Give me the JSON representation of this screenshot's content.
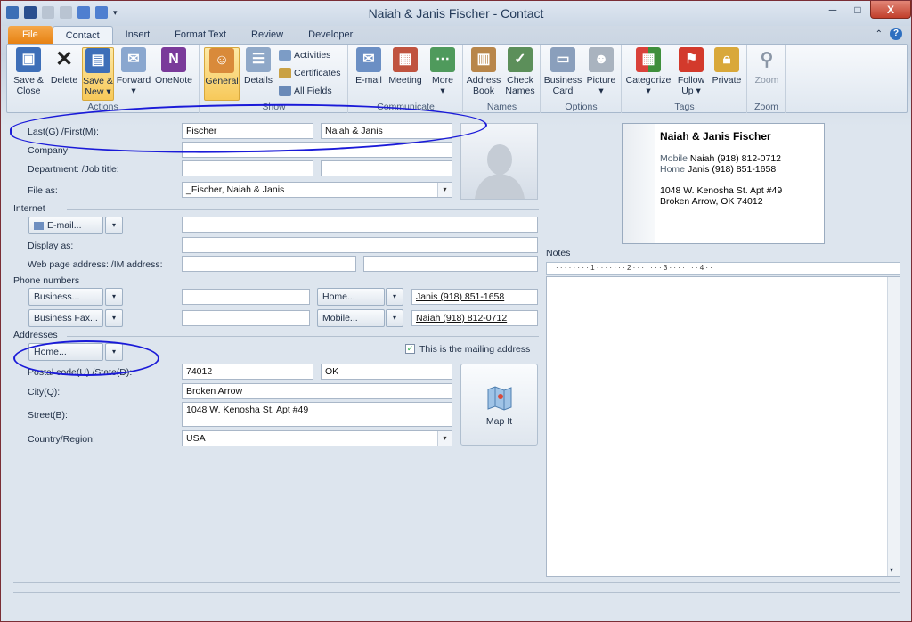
{
  "window": {
    "title": "Naiah & Janis Fischer  -  Contact",
    "controls": {
      "minimize": "─",
      "maximize": "□",
      "close": "X"
    }
  },
  "tabs": [
    "File",
    "Contact",
    "Insert",
    "Format Text",
    "Review",
    "Developer"
  ],
  "ribbon": {
    "actions": {
      "label": "Actions",
      "save_close": "Save &\nClose",
      "delete": "Delete",
      "save_new": "Save &\nNew ▾",
      "forward": "Forward\n▾",
      "onenote": "OneNote"
    },
    "show": {
      "label": "Show",
      "general": "General",
      "details": "Details",
      "activities": "Activities",
      "certificates": "Certificates",
      "all_fields": "All Fields"
    },
    "communicate": {
      "label": "Communicate",
      "email": "E-mail",
      "meeting": "Meeting",
      "more": "More\n▾"
    },
    "names": {
      "label": "Names",
      "address_book": "Address\nBook",
      "check_names": "Check\nNames"
    },
    "options": {
      "label": "Options",
      "business_card": "Business\nCard",
      "picture": "Picture\n▾"
    },
    "tags": {
      "label": "Tags",
      "categorize": "Categorize\n▾",
      "follow_up": "Follow\nUp ▾",
      "private": "Private"
    },
    "zoom": {
      "label": "Zoom",
      "zoom": "Zoom"
    }
  },
  "form": {
    "last_first_label": "Last(G)   /First(M):",
    "last": "Fischer",
    "first": "Naiah & Janis",
    "company_label": "Company:",
    "department_label": "Department:   /Job title:",
    "file_as_label": "File as:",
    "file_as": "_Fischer, Naiah & Janis",
    "internet_section": "Internet",
    "email_button": "E-mail...",
    "display_as_label": "Display as:",
    "webpage_label": "Web page address:   /IM address:",
    "phone_section": "Phone numbers",
    "business_btn": "Business...",
    "business_fax_btn": "Business Fax...",
    "home_btn": "Home...",
    "mobile_btn": "Mobile...",
    "home_phone": "Janis (918) 851-1658",
    "mobile_phone": "Naiah (918) 812-0712",
    "addresses_section": "Addresses",
    "address_type_btn": "Home...",
    "mailing_label": "This is the mailing address",
    "mailing_checked": "✓",
    "postal_label": "Postal code(U)   /State(D):",
    "postal": "74012",
    "state": "OK",
    "city_label": "City(Q):",
    "city": "Broken Arrow",
    "street_label": "Street(B):",
    "street": "1048 W. Kenosha St. Apt #49",
    "country_label": "Country/Region:",
    "country": "USA",
    "map_it": "Map It"
  },
  "business_card": {
    "name": "Naiah & Janis Fischer",
    "mobile_key": "Mobile",
    "mobile": "Naiah (918) 812-0712",
    "home_key": "Home",
    "home": "Janis (918) 851-1658",
    "addr1": "1048 W. Kenosha St. Apt #49",
    "addr2": "Broken Arrow, OK 74012"
  },
  "notes": {
    "label": "Notes",
    "ruler": "·  ·  ·  ·  ·  ·  ·  ·  1  ·  ·  ·  ·  ·  ·  ·  2  ·  ·  ·  ·  ·  ·  ·  3  ·  ·  ·  ·  ·  ·  ·  4  ·  ·"
  },
  "colors": {
    "accent": "#e67f10",
    "annotation": "#1a1ad8",
    "selected": "#f7c95a"
  }
}
